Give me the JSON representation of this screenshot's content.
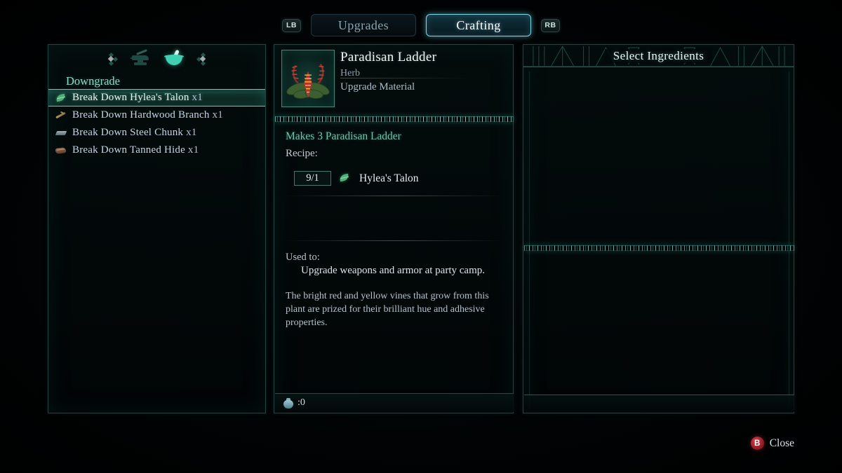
{
  "tabs": {
    "left_bumper": "LB",
    "right_bumper": "RB",
    "items": [
      {
        "label": "Upgrades",
        "active": false
      },
      {
        "label": "Crafting",
        "active": true
      }
    ]
  },
  "left_panel": {
    "categories": [
      {
        "name": "prev-arrow",
        "icon": "arrow-left-diamond"
      },
      {
        "name": "anvil",
        "icon": "anvil-icon",
        "active": false
      },
      {
        "name": "mortar",
        "icon": "mortar-pestle-icon",
        "active": true
      },
      {
        "name": "next-arrow",
        "icon": "arrow-right-diamond"
      }
    ],
    "header": "Downgrade",
    "items": [
      {
        "label": "Break Down Hylea's Talon",
        "qty": "x1",
        "icon": "leaf-icon",
        "selected": true
      },
      {
        "label": "Break Down Hardwood Branch",
        "qty": "x1",
        "icon": "branch-icon",
        "selected": false
      },
      {
        "label": "Break Down Steel Chunk",
        "qty": "x1",
        "icon": "ingot-icon",
        "selected": false
      },
      {
        "label": "Break Down Tanned Hide",
        "qty": "x1",
        "icon": "hide-icon",
        "selected": false
      }
    ]
  },
  "detail": {
    "item_name": "Paradisan Ladder",
    "item_category": "Herb",
    "item_type": "Upgrade Material",
    "makes": "Makes 3 Paradisan Ladder",
    "recipe_label": "Recipe:",
    "ingredients": [
      {
        "quantity": "9/1",
        "name": "Hylea's Talon",
        "icon": "leaf-icon"
      }
    ],
    "used_to_label": "Used to:",
    "used_to_text": "Upgrade weapons and armor at party camp.",
    "flavor_text": "The bright red and yellow vines that grow from this plant are prized for their brilliant hue and adhesive properties.",
    "currency_value": ":0",
    "currency_icon": "money-pouch-icon"
  },
  "right_panel": {
    "title": "Select Ingredients",
    "items": []
  },
  "footer": {
    "close_button_glyph": "B",
    "close_label": "Close"
  },
  "colors": {
    "accent_teal": "#6fc6a8",
    "accent_cyan": "#7fd8e8",
    "panel_border": "#1d4640",
    "text_primary": "#e6edf1",
    "text_muted": "#8d9fae",
    "close_red": "#c8323c"
  }
}
